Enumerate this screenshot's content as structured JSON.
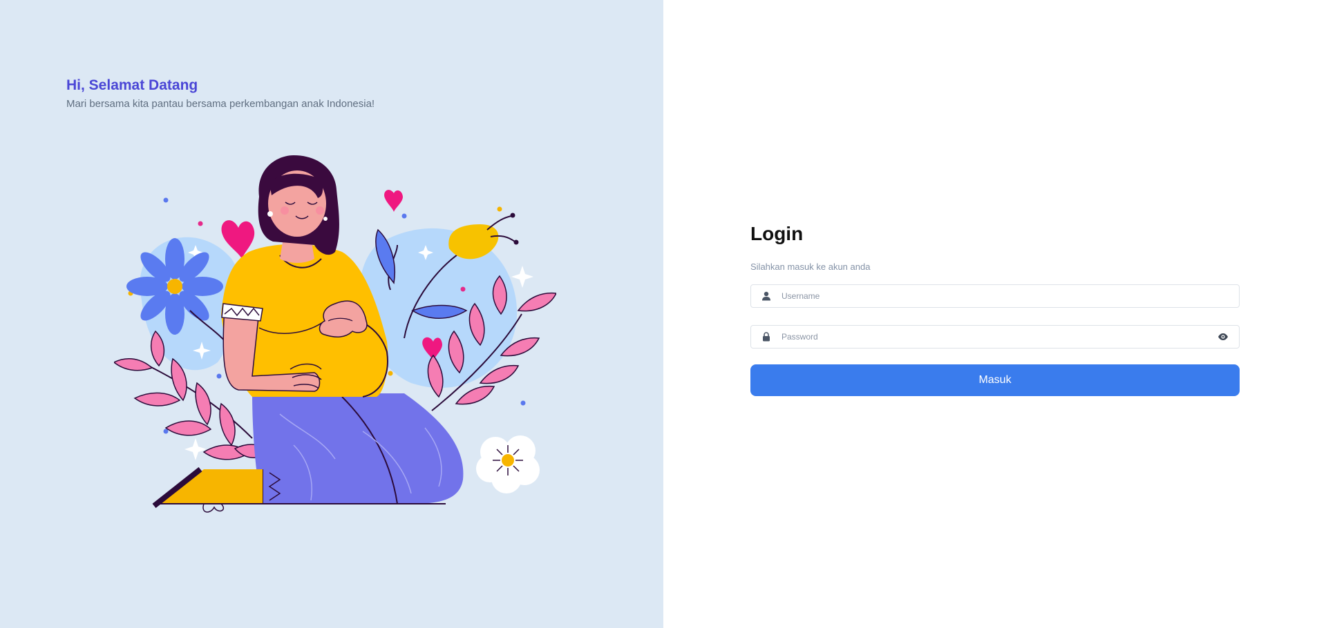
{
  "greeting": {
    "title": "Hi, Selamat Datang",
    "subtitle": "Mari bersama kita pantau bersama perkembangan anak Indonesia!"
  },
  "illustration": {
    "subject": "pregnant woman with flowers"
  },
  "login": {
    "title": "Login",
    "subtitle": "Silahkan masuk ke akun anda",
    "username_placeholder": "Username",
    "username_value": "",
    "password_placeholder": "Password",
    "password_value": "",
    "submit_label": "Masuk"
  },
  "icons": {
    "username": "user-icon",
    "password": "lock-icon",
    "toggle": "eye-icon"
  },
  "colors": {
    "accent": "#3a7ced",
    "greeting_title": "#4a46d6",
    "left_background": "#dce8f4"
  }
}
